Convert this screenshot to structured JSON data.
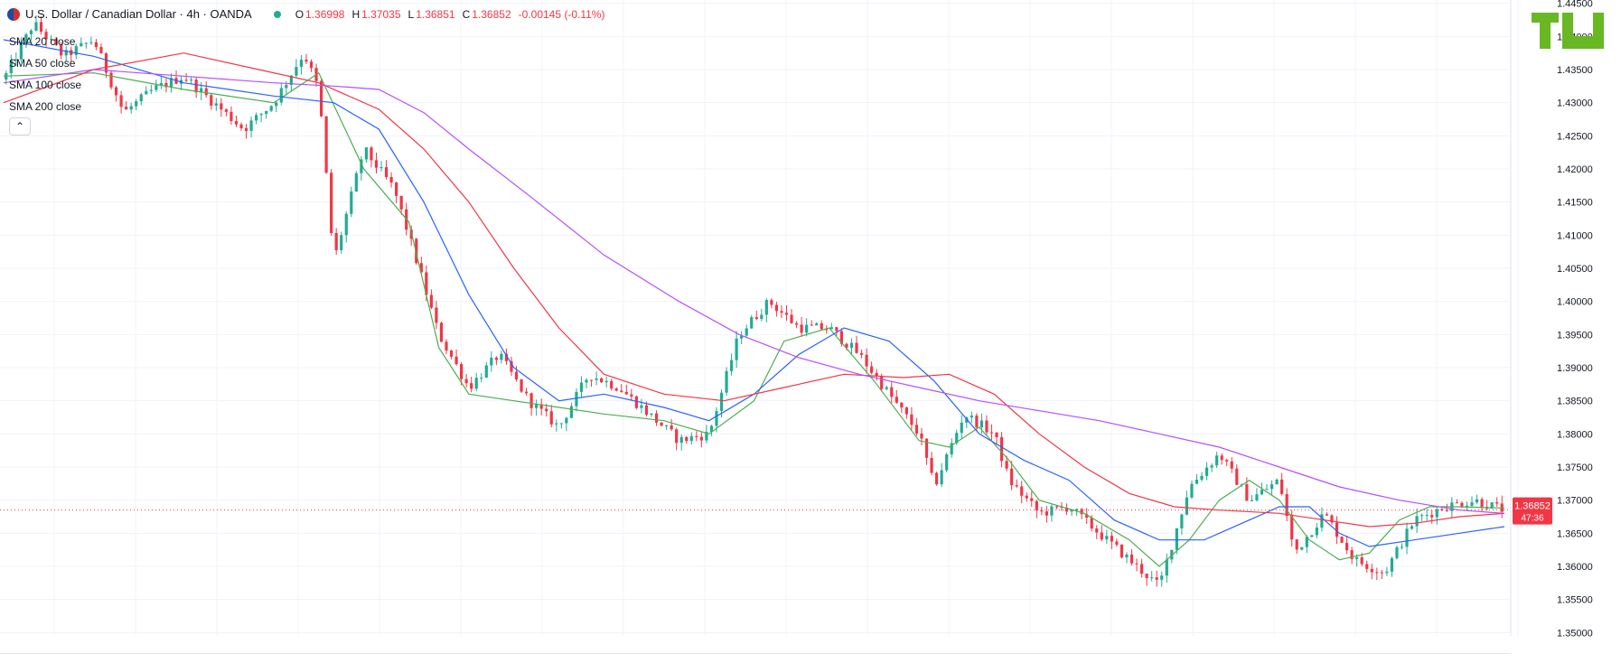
{
  "header": {
    "symbol_title": "U.S. Dollar / Canadian Dollar · 4h · OANDA",
    "ohlc": [
      {
        "label": "O",
        "value": "1.36998"
      },
      {
        "label": "H",
        "value": "1.37035"
      },
      {
        "label": "L",
        "value": "1.36851"
      },
      {
        "label": "C",
        "value": "1.36852"
      },
      {
        "label": "",
        "value": "-0.00145 (-0.11%)"
      }
    ]
  },
  "legend": [
    "SMA 20 close",
    "SMA 50 close",
    "SMA 100 close",
    "SMA 200 close"
  ],
  "price_tag": {
    "price": "1.36852",
    "countdown": "47:36"
  },
  "colors": {
    "up": "#22ab94",
    "down": "#f23645",
    "sma20": "#4caf50",
    "sma50": "#2962ff",
    "sma100": "#f23645",
    "sma200": "#b84dff",
    "logo": "#68b723"
  },
  "icons": {
    "collapse": "chevron-up-icon",
    "logo": "tradingview-logo"
  },
  "chart_data": {
    "type": "line",
    "title": "U.S. Dollar / Canadian Dollar · 4h · OANDA",
    "y_ticks": [
      "1.44500",
      "1.44000",
      "1.43500",
      "1.43000",
      "1.42500",
      "1.42000",
      "1.41500",
      "1.41000",
      "1.40500",
      "1.40000",
      "1.39500",
      "1.39000",
      "1.38500",
      "1.38000",
      "1.37500",
      "1.37000",
      "1.36500",
      "1.36000",
      "1.35500",
      "1.35000"
    ],
    "ylim": [
      1.3495,
      1.4455
    ],
    "grid": true,
    "x_index_range": [
      0,
      100
    ],
    "price_path": [
      [
        0,
        1.4335
      ],
      [
        2,
        1.442
      ],
      [
        4,
        1.437
      ],
      [
        6,
        1.4395
      ],
      [
        8,
        1.4285
      ],
      [
        10,
        1.432
      ],
      [
        12,
        1.434
      ],
      [
        14,
        1.43
      ],
      [
        16,
        1.426
      ],
      [
        18,
        1.43
      ],
      [
        20,
        1.4375
      ],
      [
        21,
        1.432
      ],
      [
        22,
        1.406
      ],
      [
        24,
        1.423
      ],
      [
        26,
        1.417
      ],
      [
        27,
        1.41
      ],
      [
        29,
        1.395
      ],
      [
        31,
        1.387
      ],
      [
        33,
        1.392
      ],
      [
        35,
        1.385
      ],
      [
        37,
        1.381
      ],
      [
        39,
        1.389
      ],
      [
        41,
        1.387
      ],
      [
        43,
        1.383
      ],
      [
        45,
        1.379
      ],
      [
        47,
        1.38
      ],
      [
        49,
        1.395
      ],
      [
        51,
        1.4
      ],
      [
        53,
        1.396
      ],
      [
        55,
        1.396
      ],
      [
        57,
        1.392
      ],
      [
        59,
        1.386
      ],
      [
        61,
        1.38
      ],
      [
        62,
        1.372
      ],
      [
        64,
        1.383
      ],
      [
        66,
        1.38
      ],
      [
        67,
        1.373
      ],
      [
        69,
        1.368
      ],
      [
        71,
        1.369
      ],
      [
        73,
        1.365
      ],
      [
        75,
        1.361
      ],
      [
        77,
        1.357
      ],
      [
        79,
        1.372
      ],
      [
        81,
        1.377
      ],
      [
        83,
        1.37
      ],
      [
        85,
        1.373
      ],
      [
        86,
        1.362
      ],
      [
        88,
        1.368
      ],
      [
        90,
        1.361
      ],
      [
        92,
        1.359
      ],
      [
        94,
        1.367
      ],
      [
        96,
        1.369
      ],
      [
        98,
        1.37
      ],
      [
        100,
        1.3685
      ]
    ],
    "series": [
      {
        "name": "SMA 20 close",
        "points": [
          [
            0,
            1.434
          ],
          [
            6,
            1.4345
          ],
          [
            12,
            1.432
          ],
          [
            18,
            1.43
          ],
          [
            21,
            1.4345
          ],
          [
            24,
            1.42
          ],
          [
            27,
            1.412
          ],
          [
            29,
            1.393
          ],
          [
            31,
            1.386
          ],
          [
            34,
            1.385
          ],
          [
            37,
            1.384
          ],
          [
            40,
            1.383
          ],
          [
            44,
            1.382
          ],
          [
            47,
            1.38
          ],
          [
            50,
            1.385
          ],
          [
            52,
            1.394
          ],
          [
            55,
            1.396
          ],
          [
            58,
            1.388
          ],
          [
            61,
            1.379
          ],
          [
            63,
            1.378
          ],
          [
            65,
            1.381
          ],
          [
            67,
            1.376
          ],
          [
            69,
            1.37
          ],
          [
            72,
            1.368
          ],
          [
            75,
            1.364
          ],
          [
            77,
            1.36
          ],
          [
            79,
            1.364
          ],
          [
            81,
            1.37
          ],
          [
            83,
            1.373
          ],
          [
            85,
            1.37
          ],
          [
            87,
            1.364
          ],
          [
            89,
            1.361
          ],
          [
            91,
            1.362
          ],
          [
            93,
            1.367
          ],
          [
            95,
            1.369
          ],
          [
            97,
            1.369
          ],
          [
            100,
            1.3688
          ]
        ]
      },
      {
        "name": "SMA 50 close",
        "points": [
          [
            0,
            1.4395
          ],
          [
            6,
            1.437
          ],
          [
            12,
            1.433
          ],
          [
            18,
            1.431
          ],
          [
            22,
            1.43
          ],
          [
            25,
            1.426
          ],
          [
            28,
            1.415
          ],
          [
            31,
            1.401
          ],
          [
            34,
            1.39
          ],
          [
            37,
            1.385
          ],
          [
            40,
            1.386
          ],
          [
            44,
            1.384
          ],
          [
            47,
            1.382
          ],
          [
            50,
            1.386
          ],
          [
            53,
            1.392
          ],
          [
            56,
            1.396
          ],
          [
            59,
            1.394
          ],
          [
            62,
            1.388
          ],
          [
            65,
            1.38
          ],
          [
            68,
            1.376
          ],
          [
            71,
            1.373
          ],
          [
            74,
            1.367
          ],
          [
            77,
            1.364
          ],
          [
            80,
            1.364
          ],
          [
            83,
            1.367
          ],
          [
            85,
            1.369
          ],
          [
            87,
            1.369
          ],
          [
            89,
            1.365
          ],
          [
            91,
            1.363
          ],
          [
            94,
            1.364
          ],
          [
            97,
            1.365
          ],
          [
            100,
            1.366
          ]
        ]
      },
      {
        "name": "SMA 100 close",
        "points": [
          [
            0,
            1.43
          ],
          [
            6,
            1.435
          ],
          [
            12,
            1.4375
          ],
          [
            17,
            1.435
          ],
          [
            21,
            1.433
          ],
          [
            25,
            1.429
          ],
          [
            28,
            1.423
          ],
          [
            31,
            1.415
          ],
          [
            34,
            1.405
          ],
          [
            37,
            1.396
          ],
          [
            40,
            1.389
          ],
          [
            44,
            1.386
          ],
          [
            48,
            1.385
          ],
          [
            52,
            1.387
          ],
          [
            56,
            1.389
          ],
          [
            60,
            1.3885
          ],
          [
            63,
            1.389
          ],
          [
            66,
            1.386
          ],
          [
            69,
            1.38
          ],
          [
            72,
            1.375
          ],
          [
            75,
            1.371
          ],
          [
            78,
            1.369
          ],
          [
            81,
            1.3685
          ],
          [
            85,
            1.368
          ],
          [
            88,
            1.367
          ],
          [
            91,
            1.366
          ],
          [
            94,
            1.3665
          ],
          [
            97,
            1.3675
          ],
          [
            100,
            1.368
          ]
        ]
      },
      {
        "name": "SMA 200 close",
        "points": [
          [
            0,
            1.433
          ],
          [
            6,
            1.435
          ],
          [
            12,
            1.434
          ],
          [
            18,
            1.433
          ],
          [
            22,
            1.4325
          ],
          [
            25,
            1.432
          ],
          [
            28,
            1.4285
          ],
          [
            31,
            1.423
          ],
          [
            35,
            1.416
          ],
          [
            40,
            1.407
          ],
          [
            45,
            1.4
          ],
          [
            49,
            1.395
          ],
          [
            53,
            1.3915
          ],
          [
            57,
            1.389
          ],
          [
            61,
            1.387
          ],
          [
            65,
            1.385
          ],
          [
            69,
            1.3835
          ],
          [
            73,
            1.382
          ],
          [
            77,
            1.38
          ],
          [
            81,
            1.378
          ],
          [
            85,
            1.375
          ],
          [
            89,
            1.372
          ],
          [
            93,
            1.37
          ],
          [
            97,
            1.3685
          ],
          [
            100,
            1.368
          ]
        ]
      }
    ]
  }
}
